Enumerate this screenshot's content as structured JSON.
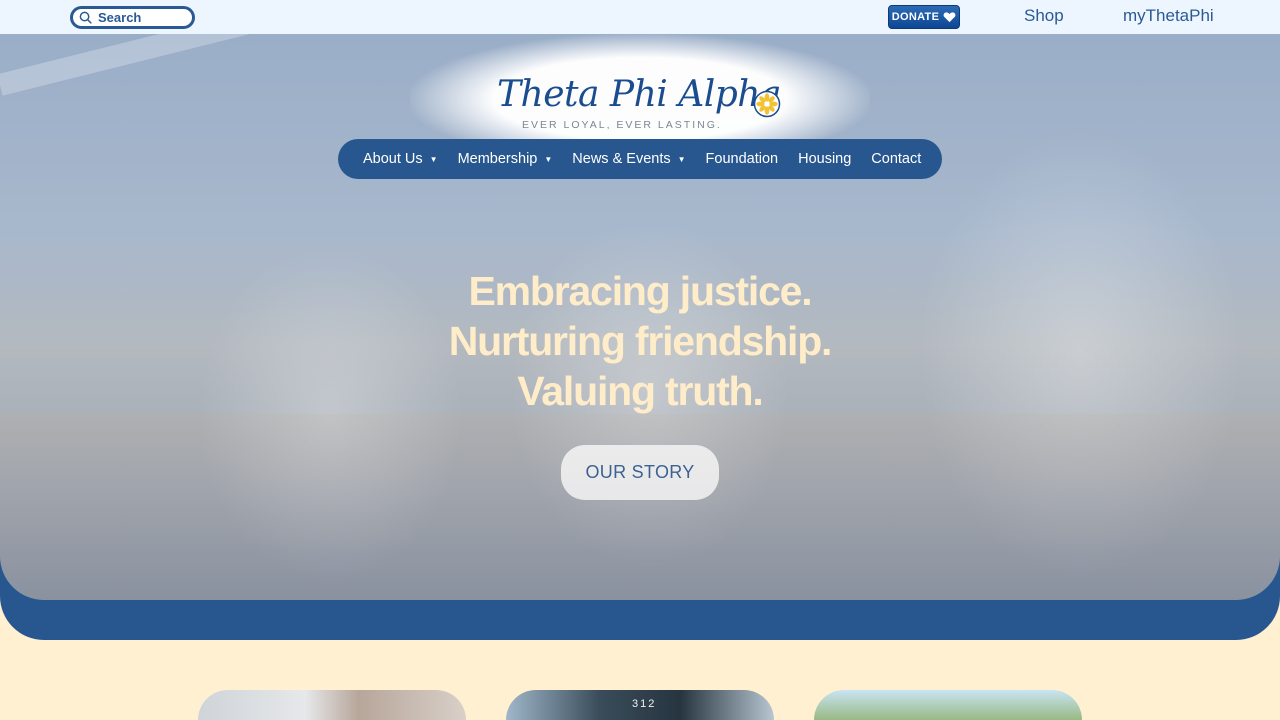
{
  "topbar": {
    "search_placeholder": "Search",
    "donate_label": "DONATE",
    "links": [
      "Shop",
      "myThetaPhi"
    ]
  },
  "logo": {
    "name": "Theta Phi Alpha",
    "tagline": "EVER LOYAL, EVER LASTING."
  },
  "nav": {
    "items": [
      {
        "label": "About Us",
        "has_dropdown": true
      },
      {
        "label": "Membership",
        "has_dropdown": true
      },
      {
        "label": "News & Events",
        "has_dropdown": true
      },
      {
        "label": "Foundation",
        "has_dropdown": false
      },
      {
        "label": "Housing",
        "has_dropdown": false
      },
      {
        "label": "Contact",
        "has_dropdown": false
      }
    ],
    "dropdown_icon": "caret-down-icon"
  },
  "hero": {
    "lines": [
      "Embracing justice.",
      "Nurturing friendship.",
      "Valuing truth."
    ],
    "cta_label": "OUR STORY"
  },
  "cards": [
    {
      "caption": ""
    },
    {
      "caption": "312"
    },
    {
      "caption": ""
    }
  ],
  "colors": {
    "brand_blue": "#27578e",
    "cream": "#fff0d2",
    "headline": "#ffecc8",
    "topbar": "#edf6ff"
  }
}
